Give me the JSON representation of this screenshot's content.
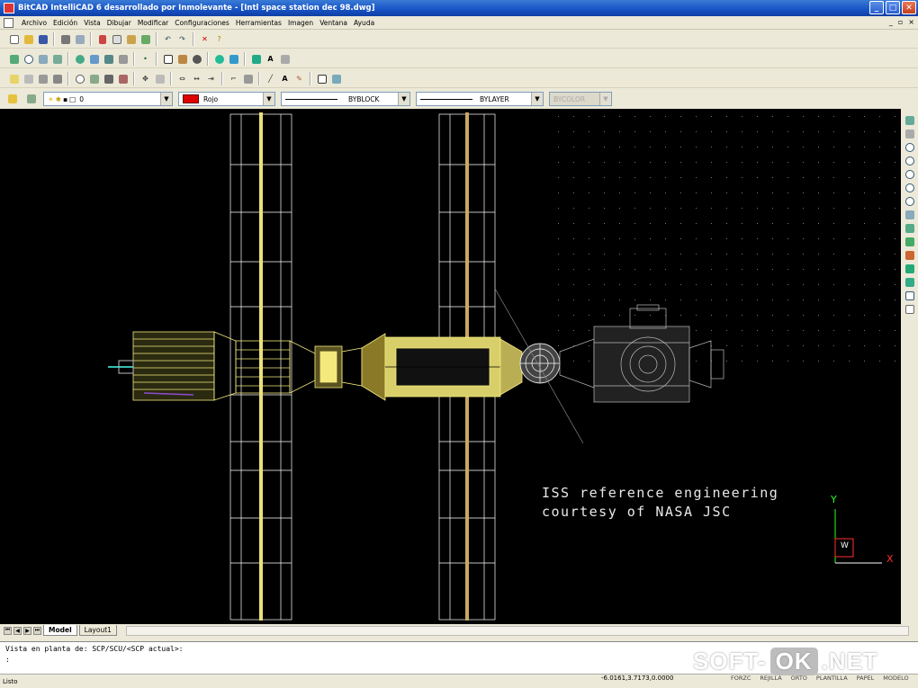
{
  "window": {
    "title": "BitCAD IntelliCAD 6 desarrollado por Inmolevante - [Intl space station dec 98.dwg]",
    "minimize": "_",
    "maximize": "□",
    "close": "✕"
  },
  "menu": {
    "items": [
      "Archivo",
      "Edición",
      "Vista",
      "Dibujar",
      "Modificar",
      "Configuraciones",
      "Herramientas",
      "Imagen",
      "Ventana",
      "Ayuda"
    ]
  },
  "props": {
    "layer_value": "0",
    "color_value": "Rojo",
    "color_hex": "#dd0000",
    "linetype_value": "BYBLOCK",
    "lineweight_value": "BYLAYER",
    "plotstyle_value": "BYCOLOR"
  },
  "drawing": {
    "annotation_line1": "ISS reference engineering",
    "annotation_line2": "courtesy of NASA JSC",
    "ucs_x": "X",
    "ucs_y": "Y",
    "ucs_w": "W",
    "colors": {
      "background": "#000000",
      "yellow": "#f3e97c",
      "white": "#ffffff",
      "truss": "#b8a64a"
    }
  },
  "tabs": [
    "Model",
    "Layout1"
  ],
  "command": {
    "line1": "Vista en planta de:  SCP/SCU/<SCP actual>:",
    "line2": ":"
  },
  "status": {
    "ready": "Listo",
    "coords": "-6.0161,3.7173,0.0000",
    "buttons": [
      "FORZC",
      "REJILLA",
      "ORTO",
      "PLANTILLA",
      "PAPEL",
      "MODELO"
    ]
  },
  "watermark": {
    "left": "SOFT-",
    "ok": "OK",
    "right": ".NET"
  }
}
